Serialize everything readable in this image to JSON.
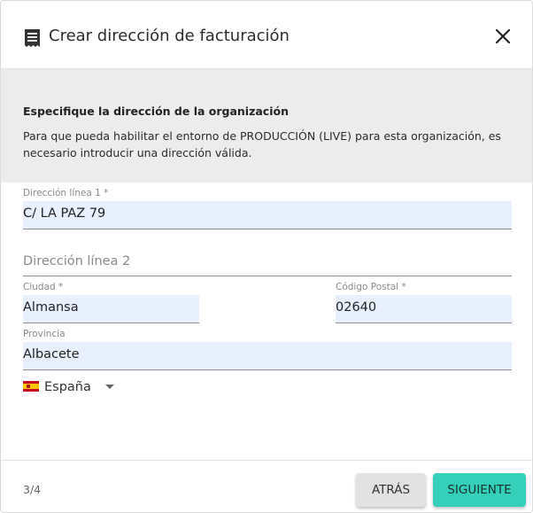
{
  "dialog": {
    "title": "Crear dirección de facturación",
    "icon": "receipt-icon",
    "close_icon": "close-icon"
  },
  "banner": {
    "title": "Especifique la dirección de la organización",
    "text": "Para que pueda habilitar el entorno de PRODUCCIÓN (LIVE) para esta organización, es necesario introducir una dirección válida."
  },
  "form": {
    "address1": {
      "label": "Dirección línea 1 *",
      "value": "C/ LA PAZ 79"
    },
    "address2": {
      "placeholder": "Dirección línea 2",
      "value": ""
    },
    "city": {
      "label": "Ciudad *",
      "value": "Almansa"
    },
    "postal_code": {
      "label": "Código Postal *",
      "value": "02640"
    },
    "province": {
      "label": "Provincia",
      "value": "Albacete"
    },
    "country": {
      "value": "España",
      "flag": "spain-flag-icon"
    }
  },
  "footer": {
    "step": "3/4",
    "back_label": "ATRÁS",
    "next_label": "SIGUIENTE"
  },
  "colors": {
    "accent": "#35d0ba",
    "field_fill": "#e8effd",
    "banner_bg": "#ececec"
  }
}
